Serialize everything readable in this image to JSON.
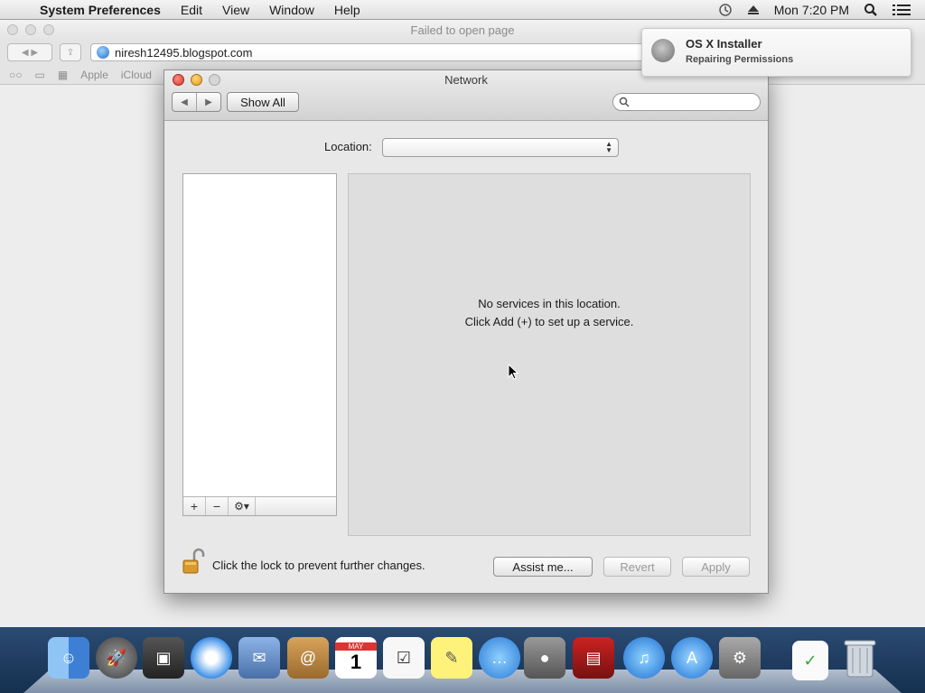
{
  "menubar": {
    "app_name": "System Preferences",
    "menus": [
      "Edit",
      "View",
      "Window",
      "Help"
    ],
    "clock": "Mon 7:20 PM"
  },
  "safari": {
    "title": "Failed to open page",
    "url": "niresh12495.blogspot.com",
    "bookmarks": [
      "Apple",
      "iCloud"
    ]
  },
  "notification": {
    "title": "OS X Installer",
    "subtitle": "Repairing Permissions"
  },
  "network": {
    "title": "Network",
    "show_all": "Show All",
    "location_label": "Location:",
    "location_value": "",
    "empty_line1": "No services in this location.",
    "empty_line2": "Click Add (+) to set up a service.",
    "lock_text": "Click the lock to prevent further changes.",
    "assist_label": "Assist me...",
    "revert_label": "Revert",
    "apply_label": "Apply",
    "list_add": "+",
    "list_remove": "−",
    "list_gear": "⚙▾"
  },
  "dock": {
    "items": [
      "Finder",
      "Launchpad",
      "Photo Booth",
      "Safari",
      "Mail",
      "Contacts",
      "Calendar",
      "Reminders",
      "Notes",
      "Messages",
      "FaceTime",
      "Photo Booth Strip",
      "iTunes",
      "App Store",
      "System Preferences",
      "Document",
      "Trash"
    ],
    "calendar_month": "MAY",
    "calendar_day": "1"
  }
}
